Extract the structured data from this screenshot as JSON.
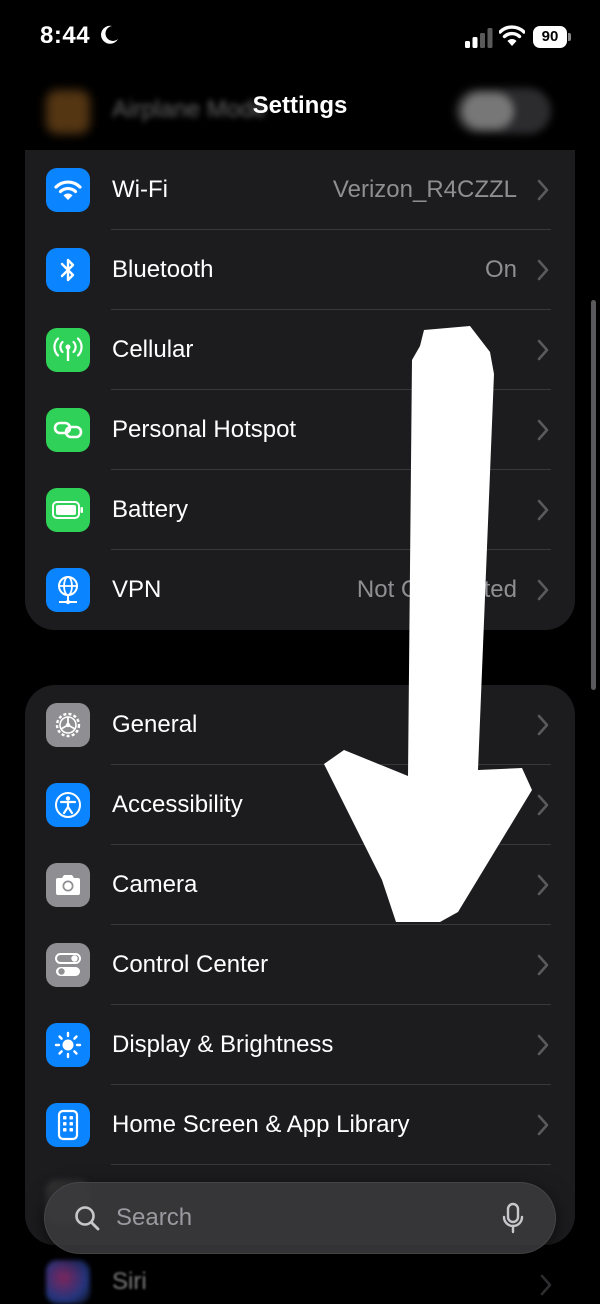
{
  "status_bar": {
    "time": "8:44",
    "battery": "90"
  },
  "nav": {
    "title": "Settings"
  },
  "ghost_top": {
    "label": "Airplane Mode"
  },
  "group1": [
    {
      "label": "Wi-Fi",
      "value": "Verizon_R4CZZL",
      "icon": "wifi-icon",
      "color": "#0a84ff"
    },
    {
      "label": "Bluetooth",
      "value": "On",
      "icon": "bluetooth-icon",
      "color": "#0a84ff"
    },
    {
      "label": "Cellular",
      "value": "",
      "icon": "cellular-icon",
      "color": "#30d158"
    },
    {
      "label": "Personal Hotspot",
      "value": "",
      "icon": "hotspot-icon",
      "color": "#30d158"
    },
    {
      "label": "Battery",
      "value": "",
      "icon": "battery-icon",
      "color": "#30d158"
    },
    {
      "label": "VPN",
      "value": "Not Connected",
      "icon": "vpn-globe-icon",
      "color": "#0a84ff"
    }
  ],
  "group2": [
    {
      "label": "General",
      "icon": "gear-icon",
      "color": "#8e8e93"
    },
    {
      "label": "Accessibility",
      "icon": "accessibility-icon",
      "color": "#0a84ff"
    },
    {
      "label": "Camera",
      "icon": "camera-icon",
      "color": "#8e8e93"
    },
    {
      "label": "Control Center",
      "icon": "control-center-icon",
      "color": "#8e8e93"
    },
    {
      "label": "Display & Brightness",
      "icon": "sun-icon",
      "color": "#0a84ff"
    },
    {
      "label": "Home Screen & App Library",
      "icon": "home-screen-icon",
      "color": "#0a84ff"
    }
  ],
  "ghost_bottom": {
    "siri_label": "Siri"
  },
  "search": {
    "placeholder": "Search"
  }
}
